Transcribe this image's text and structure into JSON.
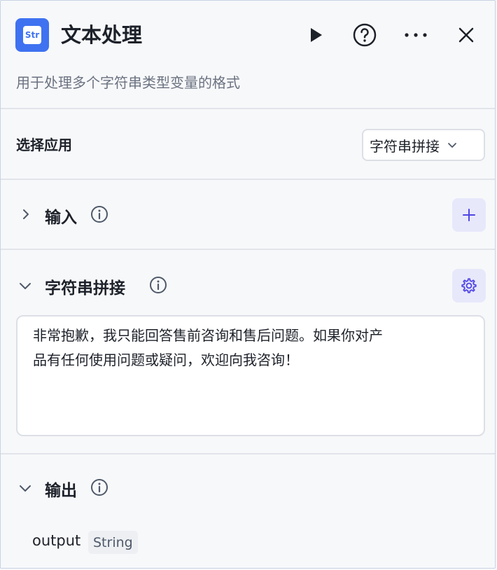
{
  "header": {
    "app_icon_text": "Str",
    "title": "文本处理",
    "subtitle": "用于处理多个字符串类型变量的格式"
  },
  "settings": {
    "select_app_label": "选择应用",
    "selected_app": "字符串拼接"
  },
  "input_section": {
    "title": "输入"
  },
  "concat_section": {
    "title": "字符串拼接",
    "text_line1": "非常抱歉，我只能回答售前咨询和售后问题。如果你对产",
    "text_line2": "品有任何使用问题或疑问，欢迎向我咨询！"
  },
  "output_section": {
    "title": "输出",
    "var_name": "output",
    "var_type": "String"
  },
  "colors": {
    "accent": "#3f72f0",
    "action_button_bg": "#e8e8fb",
    "action_button_icon": "#4f46e5"
  },
  "icons": [
    "play-icon",
    "help-icon",
    "more-icon",
    "close-icon",
    "chevron-right-icon",
    "chevron-down-icon",
    "info-icon",
    "plus-icon",
    "gear-icon"
  ]
}
